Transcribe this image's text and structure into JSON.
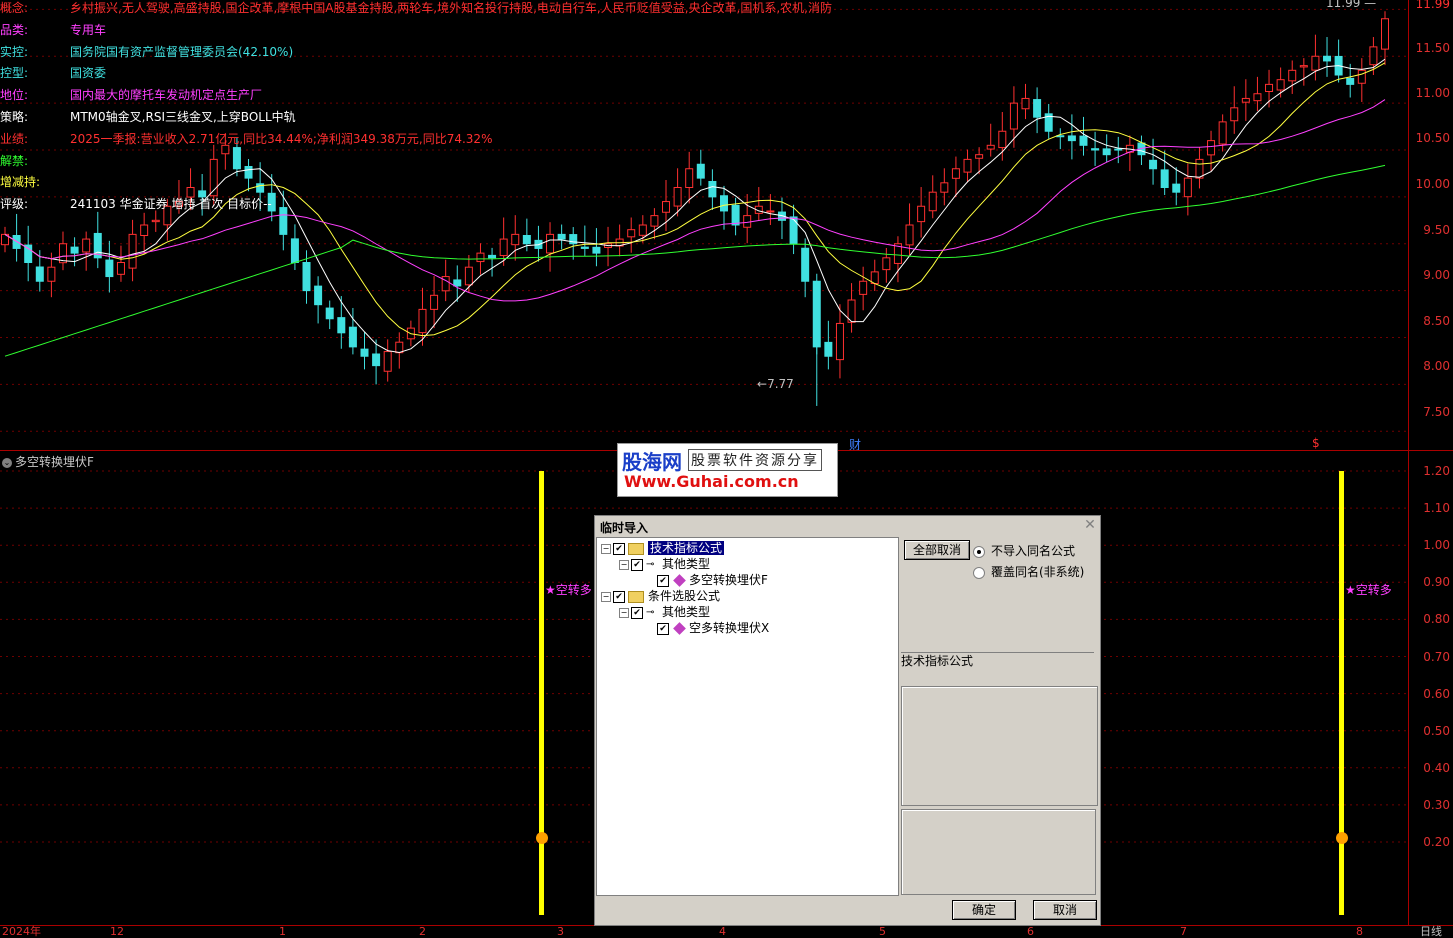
{
  "stock_info": [
    {
      "key": "概念:",
      "value": "乡村振兴,无人驾驶,高盛持股,国企改革,摩根中国A股基金持股,两轮车,境外知名投行持股,电动自行车,人民币贬值受益,央企改革,国机系,农机,消防",
      "key_color": "#ff3030",
      "value_color": "#ff3030"
    },
    {
      "key": "品类:",
      "value": "专用车",
      "key_color": "#ff40ff",
      "value_color": "#ff40ff"
    },
    {
      "key": "实控:",
      "value": "国务院国有资产监督管理委员会(42.10%)",
      "key_color": "#40e0e0",
      "value_color": "#40e0e0"
    },
    {
      "key": "控型:",
      "value": "国资委",
      "key_color": "#40e0e0",
      "value_color": "#40e0e0"
    },
    {
      "key": "地位:",
      "value": "国内最大的摩托车发动机定点生产厂",
      "key_color": "#ff40ff",
      "value_color": "#ff40ff"
    },
    {
      "key": "策略:",
      "value": "MTM0轴金叉,RSI三线金叉,上穿BOLL中轨",
      "key_color": "#ffffff",
      "value_color": "#ffffff"
    },
    {
      "key": "业绩:",
      "value": "2025一季报:营业收入2.71亿元,同比34.44%;净利润349.38万元,同比74.32%",
      "key_color": "#ff3030",
      "value_color": "#ff3030"
    },
    {
      "key": "解禁:",
      "value": "",
      "key_color": "#30ff30",
      "value_color": "#30ff30"
    },
    {
      "key": "增减持:",
      "value": "",
      "key_color": "#ffff40",
      "value_color": "#ffff40"
    },
    {
      "key": "评级:",
      "value": "241103 华金证券 增持 首次 目标价--",
      "key_color": "#ffffff",
      "value_color": "#ffffff"
    }
  ],
  "price_axis": [
    "11.99",
    "11.50",
    "11.00",
    "10.50",
    "10.00",
    "9.50",
    "9.00",
    "8.50",
    "8.00",
    "7.50"
  ],
  "chart_data": {
    "type": "candlestick",
    "high_marker": "11.99",
    "low_marker": "7.77",
    "ylim": [
      7.3,
      12.1
    ],
    "event_markers": [
      "财",
      "$"
    ],
    "closes": [
      9.6,
      9.45,
      9.3,
      9.1,
      9.25,
      9.5,
      9.4,
      9.55,
      9.35,
      9.15,
      9.3,
      9.6,
      9.7,
      9.75,
      9.9,
      9.95,
      10.1,
      10.0,
      10.4,
      10.55,
      10.3,
      10.2,
      10.05,
      9.85,
      9.6,
      9.3,
      9.0,
      8.85,
      8.7,
      8.55,
      8.4,
      8.3,
      8.2,
      8.35,
      8.45,
      8.6,
      8.8,
      8.95,
      9.15,
      9.05,
      9.25,
      9.4,
      9.35,
      9.55,
      9.6,
      9.5,
      9.45,
      9.6,
      9.55,
      9.5,
      9.45,
      9.4,
      9.5,
      9.55,
      9.65,
      9.7,
      9.8,
      9.95,
      10.1,
      10.3,
      10.2,
      10.0,
      9.85,
      9.7,
      9.8,
      9.9,
      9.85,
      9.75,
      9.5,
      9.1,
      8.4,
      8.3,
      8.65,
      8.9,
      9.1,
      9.2,
      9.35,
      9.5,
      9.7,
      9.9,
      10.05,
      10.15,
      10.3,
      10.4,
      10.45,
      10.55,
      10.7,
      11.0,
      11.05,
      10.85,
      10.7,
      10.65,
      10.6,
      10.55,
      10.5,
      10.45,
      10.5,
      10.55,
      10.45,
      10.3,
      10.1,
      10.05,
      10.2,
      10.4,
      10.6,
      10.8,
      10.95,
      11.05,
      11.1,
      11.2,
      11.25,
      11.35,
      11.4,
      11.5,
      11.45,
      11.3,
      11.2,
      11.35,
      11.6,
      11.9
    ]
  },
  "indicator": {
    "title": "多空转换埋伏F",
    "axis": [
      "1.20",
      "1.10",
      "1.00",
      "0.90",
      "0.80",
      "0.70",
      "0.60",
      "0.50",
      "0.40",
      "0.30",
      "0.20"
    ],
    "signal_label": "★空转多"
  },
  "date_axis": {
    "labels": [
      "2024年",
      "12",
      "1",
      "2",
      "3",
      "4",
      "5",
      "6",
      "7",
      "8"
    ],
    "period": "日线"
  },
  "watermark": {
    "brand": "股海网",
    "slogan": "股票软件资源分享",
    "url": "Www.Guhai.com.cn"
  },
  "dialog": {
    "title": "临时导入",
    "tree": {
      "tech_folder": "技术指标公式",
      "tech_type": "其他类型",
      "tech_formula": "多空转换埋伏F",
      "select_folder": "条件选股公式",
      "select_type": "其他类型",
      "select_formula": "空多转换埋伏X"
    },
    "cancel_all_label": "全部取消",
    "radio_skip_label": "不导入同名公式",
    "radio_overwrite_label": "覆盖同名(非系统)",
    "category_label": "技术指标公式",
    "ok_label": "确定",
    "cancel_label": "取消"
  }
}
